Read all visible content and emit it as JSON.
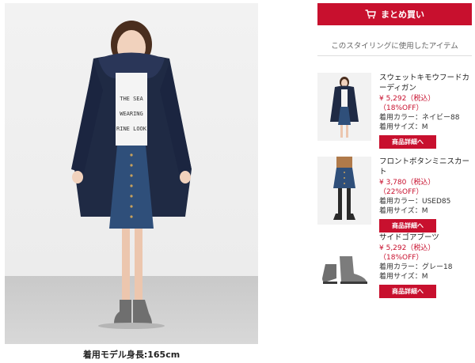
{
  "colors": {
    "accent": "#c8102e",
    "navy": "#1f2a44",
    "denim": "#2f4f7a",
    "boot_gray": "#6f6f6f"
  },
  "photo": {
    "caption": "着用モデル身長:165cm",
    "shirt_text": [
      "THE SEA",
      "WEARING",
      "RINE LOOK"
    ]
  },
  "cart": {
    "label": "まとめ買い",
    "icon": "cart-icon"
  },
  "section_title": "このスタイリングに使用したアイテム",
  "products": [
    {
      "name": "スウェットキモウフードカーディガン",
      "price": "¥ 5,292（税込）",
      "discount": "（18%OFF）",
      "color_label": "着用カラー：ネイビー88",
      "size_label": "着用サイズ：M",
      "button": "商品詳細へ"
    },
    {
      "name": "フロントボタンミニスカート",
      "price": "¥ 3,780（税込）",
      "discount": "（22%OFF）",
      "color_label": "着用カラー：USED85",
      "size_label": "着用サイズ：M",
      "button": "商品詳細へ"
    },
    {
      "name": "サイドゴアブーツ",
      "price": "¥ 5,292（税込）",
      "discount": "（18%OFF）",
      "color_label": "着用カラー：グレー18",
      "size_label": "着用サイズ：M",
      "button": "商品詳細へ"
    }
  ]
}
